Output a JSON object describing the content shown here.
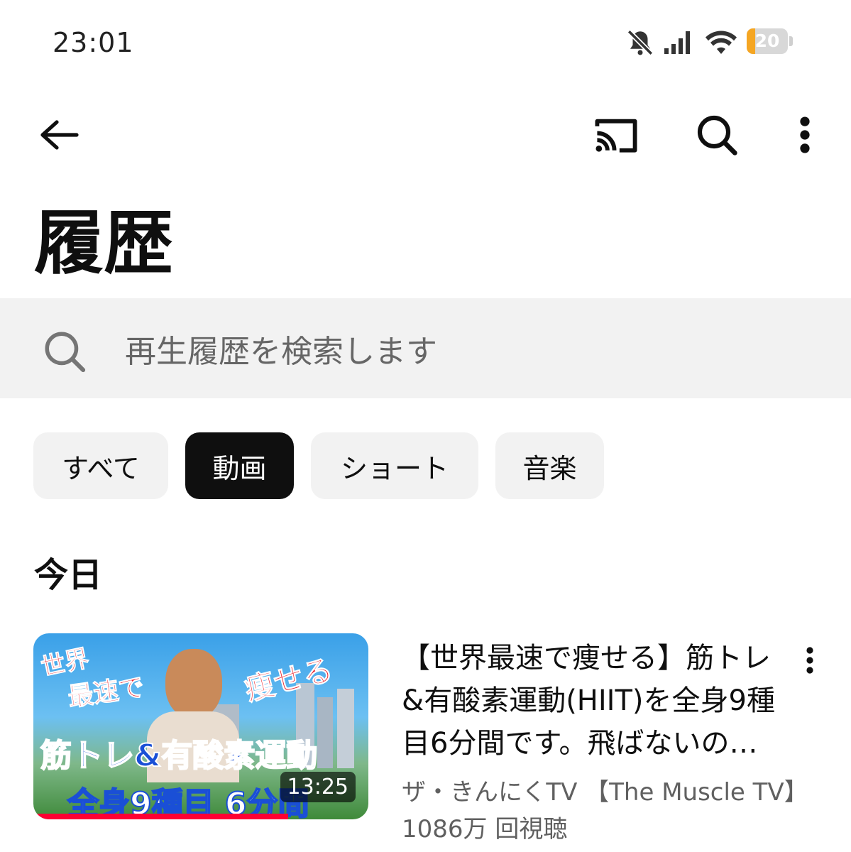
{
  "status_bar": {
    "time": "23:01",
    "icons": [
      "bell-muted-icon",
      "signal-icon",
      "wifi-icon"
    ],
    "battery_level": "20",
    "battery_fraction": 0.2,
    "battery_color": "#f5a623"
  },
  "app_bar": {
    "back_icon": "arrow-left-icon",
    "actions": [
      "cast-icon",
      "search-icon",
      "more-vert-icon"
    ]
  },
  "page": {
    "title": "履歴"
  },
  "search": {
    "placeholder": "再生履歴を検索します",
    "icon": "search-icon"
  },
  "chips": [
    {
      "label": "すべて",
      "active": false
    },
    {
      "label": "動画",
      "active": true
    },
    {
      "label": "ショート",
      "active": false
    },
    {
      "label": "音楽",
      "active": false
    }
  ],
  "sections": [
    {
      "heading": "今日",
      "videos": [
        {
          "title": "【世界最速で痩せる】筋トレ&有酸素運動(HIIT)を全身9種目6分間です。飛ばないので…",
          "channel": "ザ・きんにくTV 【The Muscle TV】",
          "views": "1086万 回視聴",
          "duration": "13:25",
          "watched_fraction": 0.76,
          "thumbnail_text": {
            "line1": "世界",
            "line2": "最速で",
            "line3": "痩せる",
            "line4": "筋トレ&有酸素運動",
            "line5": "全身9種目 6分間"
          }
        }
      ]
    }
  ],
  "colors": {
    "accent": "#ff0033",
    "chip_active_bg": "#0f0f0f",
    "chip_bg": "#f2f2f2",
    "secondary_text": "#606060"
  }
}
